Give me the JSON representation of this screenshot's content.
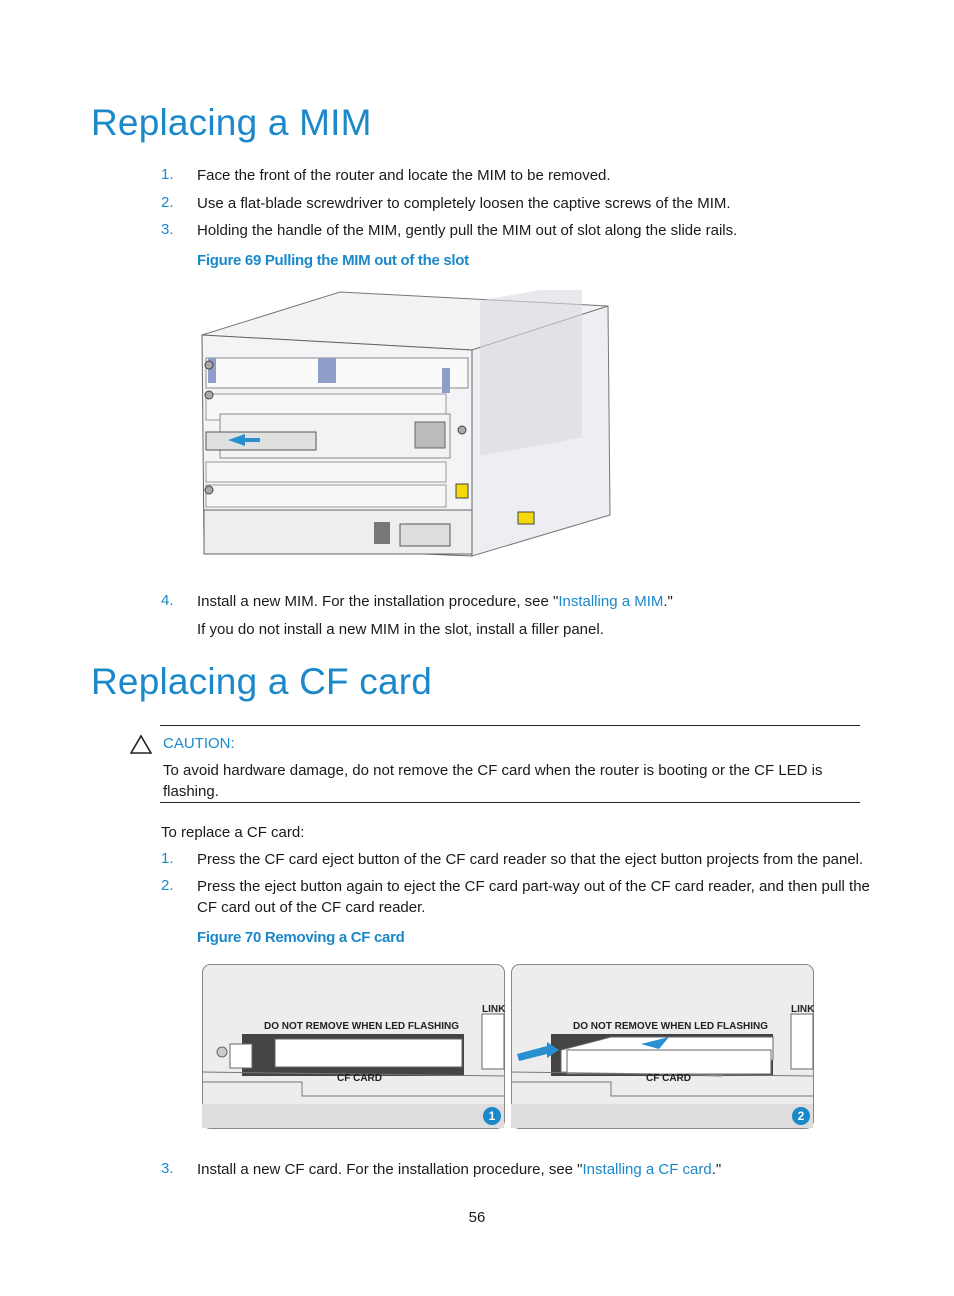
{
  "section1": {
    "title": "Replacing a MIM",
    "steps": [
      {
        "num": "1.",
        "text": "Face the front of the router and locate the MIM to be removed."
      },
      {
        "num": "2.",
        "text": "Use a flat-blade screwdriver to completely loosen the captive screws of the MIM."
      },
      {
        "num": "3.",
        "text": "Holding the handle of the MIM, gently pull the MIM out of slot along the slide rails."
      }
    ],
    "figure_caption": "Figure 69 Pulling the MIM out of the slot",
    "step4": {
      "num": "4.",
      "before": "Install a new MIM. For the installation procedure, see \"",
      "link": "Installing a MIM",
      "after": ".\"",
      "note": "If you do not install a new MIM in the slot, install a filler panel."
    }
  },
  "section2": {
    "title": "Replacing a CF card",
    "caution_label": "CAUTION:",
    "caution_text": "To avoid hardware damage, do not remove the CF card when the router is booting or the CF LED is flashing.",
    "intro": "To replace a CF card:",
    "steps": [
      {
        "num": "1.",
        "text": "Press the CF card eject button of the CF card reader so that the eject button projects from the panel."
      },
      {
        "num": "2.",
        "text": "Press the eject button again to eject the CF card part-way out of the CF card reader, and then pull the CF card out of the CF card reader."
      }
    ],
    "figure_caption": "Figure 70 Removing a CF card",
    "figure_labels": {
      "warning": "DO NOT REMOVE WHEN LED FLASHING",
      "slot": "CF CARD",
      "link": "LINK",
      "badge1": "1",
      "badge2": "2"
    },
    "step3": {
      "num": "3.",
      "before": "Install a new CF card. For the installation procedure, see \"",
      "link": "Installing a CF card",
      "after": ".\""
    }
  },
  "footer": {
    "page_number": "56"
  },
  "colors": {
    "accent": "#1a88c9",
    "arrow": "#2a8fd0"
  }
}
